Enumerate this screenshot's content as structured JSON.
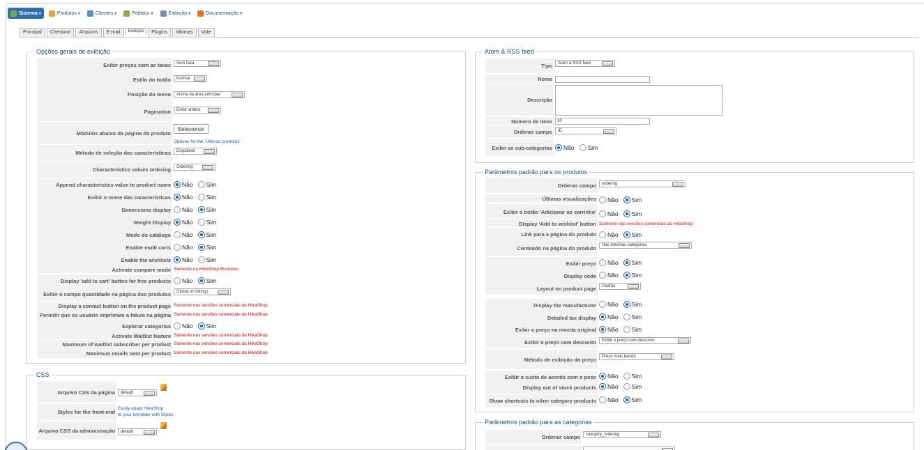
{
  "menu": [
    {
      "label": "Sistema",
      "active": true,
      "icon": "wrench-icon",
      "color": "#7aa64b"
    },
    {
      "label": "Produtos",
      "icon": "box-icon",
      "color": "#e8a23a"
    },
    {
      "label": "Clientes",
      "icon": "users-icon",
      "color": "#5a8fcf"
    },
    {
      "label": "Pedidos",
      "icon": "cart-icon",
      "color": "#9aa84c"
    },
    {
      "label": "Exibição",
      "icon": "display-icon",
      "color": "#7b8fa8"
    },
    {
      "label": "Documentação",
      "icon": "lifebuoy-icon",
      "color": "#e66a2c"
    }
  ],
  "tabs": [
    "Principal",
    "Checkout",
    "Arquivos",
    "E-mail",
    "Exibição",
    "Plugins",
    "Idiomas",
    "Vote"
  ],
  "general": {
    "title": "Opções gerais de exibição",
    "labels": [
      "Exibir preços com as taxas",
      "Estilo do botão",
      "Posição do menu",
      "Pagination",
      "Módulos abaixo da página do produto",
      "Método de seleção das características",
      "Characteristics values ordering",
      "Append characteristics value to product name",
      "Exibir o nome das características",
      "Dimensions display",
      "Weight Display",
      "Modo do catálogo",
      "Enable multi carts",
      "Enable the wishlists",
      "Activate compare mode",
      "Display 'add to cart' button for free products",
      "Exibir o campo quantidade na página dos produtos",
      "Display a contact button on the product page",
      "Permitir que os usuário imprimam a fatura na página",
      "Explorar categorias",
      "Activate Waitlist feature",
      "Maximum of waitlist subscriber per product",
      "Maximum emails sent per product"
    ],
    "tax_value": "Sem taxa",
    "button_style": "Normal",
    "menu_position": "Acima da área principal",
    "pagination": "Exibir ambos",
    "select_button": "Selecionar",
    "modules_hint": "Options for the 'Últimos produtos'",
    "char_selection": "Dropdown",
    "char_ordering": "Ordering",
    "quantity_field": "Global on listings",
    "compare_note": "Somente na HikaShop Business",
    "commercial_note": "Somente nas versões comerciais da HikaShop",
    "no": "Não",
    "yes": "Sim"
  },
  "css": {
    "title": "CSS",
    "frontend_label": "Arquivo CSS da página",
    "frontend_value": "default",
    "styles_label": "Styles for the front-end",
    "styles_text1": "Easily adapt HikaShop",
    "styles_text2": "to your template with Styles",
    "admin_label": "Arquivo CSS da administração",
    "admin_value": "default"
  },
  "feed": {
    "title": "Atom & RSS feed",
    "labels": [
      "Tipo",
      "Nome",
      "Descrição",
      "Número de itens",
      "Ordenar campo",
      "Exibir as sub-categorias"
    ],
    "type_value": "Atom & RSS feed",
    "items_value": "10",
    "order_value": "ID"
  },
  "products": {
    "title": "Parâmetros padrão para os produtos",
    "labels": [
      "Ordenar campo",
      "Últimas visualizações",
      "Exibir o botão 'Adicionar ao carrinho'",
      "Display 'Add to wishlist' button",
      "Link para a página do produto",
      "Conteúdo na página do produto",
      "Exibir preço",
      "Display code",
      "Layout on product page",
      "Display the manufacturer",
      "Detailed tax display",
      "Exibir o preço na moeda original",
      "Exibir o preço com desconto",
      "Método de exibição do preço",
      "Exibir o custo de acordo com o peso",
      "Display out of stock products",
      "Show shortcuts to other category products"
    ],
    "order_value": "ordering",
    "content_value": "Nas mesmas categorias",
    "layout_value": "Padrão",
    "discount_value": "Exibir o preço com desconto",
    "method_value": "Preço mais barato",
    "wishlist_note": "Somente nas versões comerciais da HikaShop"
  },
  "categories": {
    "title": "Parâmetros padrão para as categorias",
    "order_label": "Ordenar campo",
    "order_value": "category_ordering"
  }
}
